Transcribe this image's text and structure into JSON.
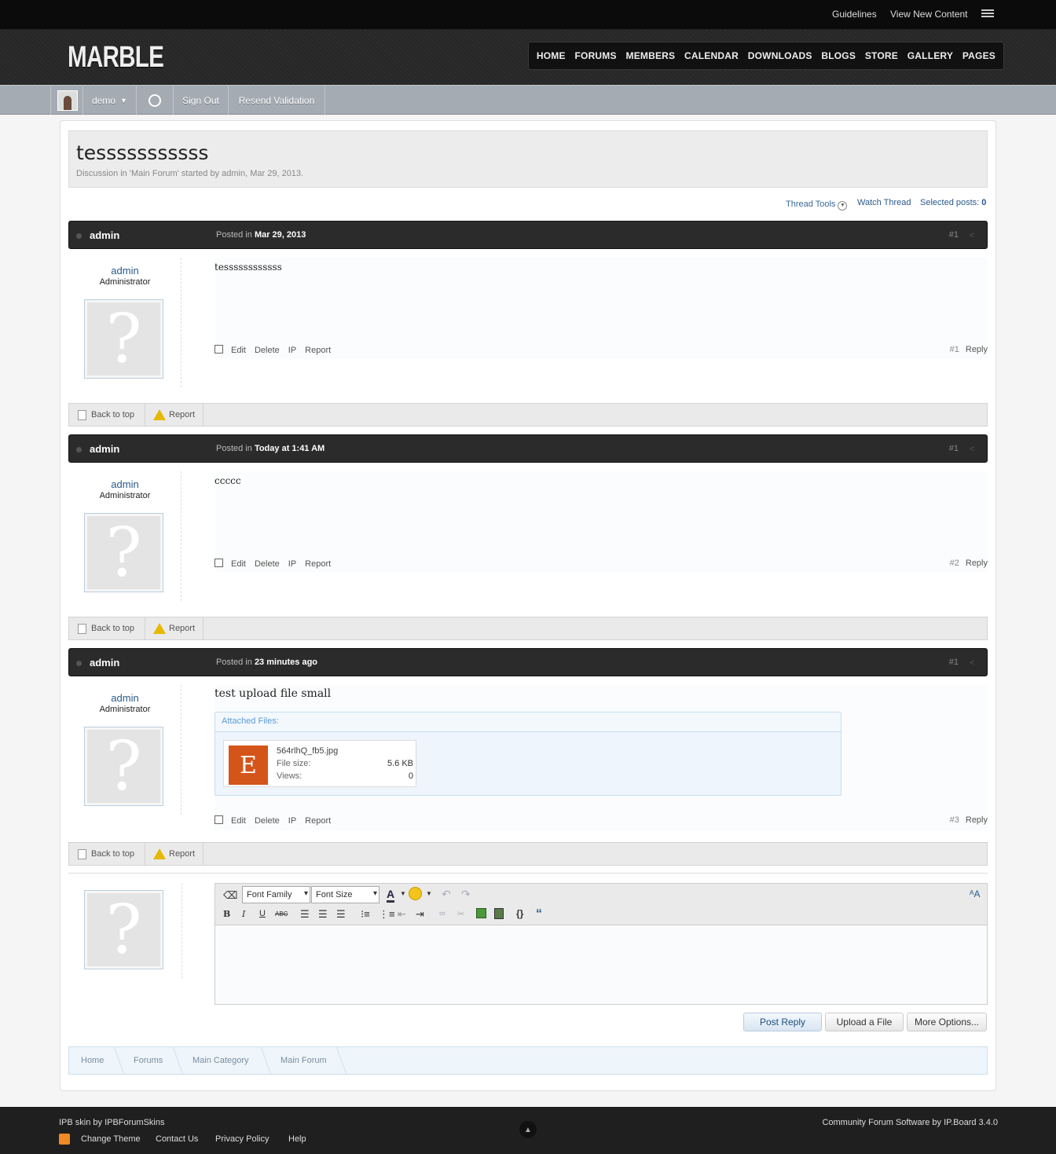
{
  "topbar": {
    "guidelines": "Guidelines",
    "view_new": "View New Content"
  },
  "logo": "MARBLE",
  "nav": [
    "HOME",
    "FORUMS",
    "MEMBERS",
    "CALENDAR",
    "DOWNLOADS",
    "BLOGS",
    "STORE",
    "GALLERY",
    "PAGES"
  ],
  "userbar": {
    "username": "demo",
    "sign_out": "Sign Out",
    "resend": "Resend Validation"
  },
  "thread": {
    "title": "tesssssssssss",
    "desc": "Discussion in 'Main Forum' started by admin, Mar 29, 2013."
  },
  "tools": {
    "thread_tools": "Thread Tools",
    "watch": "Watch Thread",
    "selected": "Selected posts:",
    "selected_count": "0"
  },
  "posts": [
    {
      "author": "admin",
      "posted_label": "Posted in",
      "posted_date": "Mar 29, 2013",
      "num": "#1",
      "title": "Administrator",
      "text": "tessssssssssss",
      "footer_num": "#1",
      "reply": "Reply"
    },
    {
      "author": "admin",
      "posted_label": "Posted in",
      "posted_date": "Today at 1:41 AM",
      "num": "#1",
      "title": "Administrator",
      "text": "ccccc",
      "footer_num": "#2",
      "reply": "Reply"
    },
    {
      "author": "admin",
      "posted_label": "Posted in",
      "posted_date": "23 minutes ago",
      "num": "#1",
      "title": "Administrator",
      "text": "test upload file small",
      "footer_num": "#3",
      "reply": "Reply"
    }
  ],
  "actions": {
    "edit": "Edit",
    "delete": "Delete",
    "ip": "IP",
    "report": "Report"
  },
  "postfoot": {
    "back": "Back to top",
    "report": "Report"
  },
  "attachment": {
    "header": "Attached Files:",
    "icon_letter": "E",
    "name": "564rlhQ_fb5.jpg",
    "size_label": "File size:",
    "size": "5.6 KB",
    "views_label": "Views:",
    "views": "0"
  },
  "editor": {
    "font_family": "Font Family",
    "font_size": "Font Size"
  },
  "buttons": {
    "post_reply": "Post Reply",
    "upload": "Upload a File",
    "more": "More Options..."
  },
  "breadcrumbs": [
    "Home",
    "Forums",
    "Main Category",
    "Main Forum"
  ],
  "footer": {
    "skin": "IPB skin by IPBForumSkins",
    "change_theme": "Change Theme",
    "contact": "Contact Us",
    "privacy": "Privacy Policy",
    "help": "Help",
    "software": "Community Forum Software by IP.Board 3.4.0"
  }
}
